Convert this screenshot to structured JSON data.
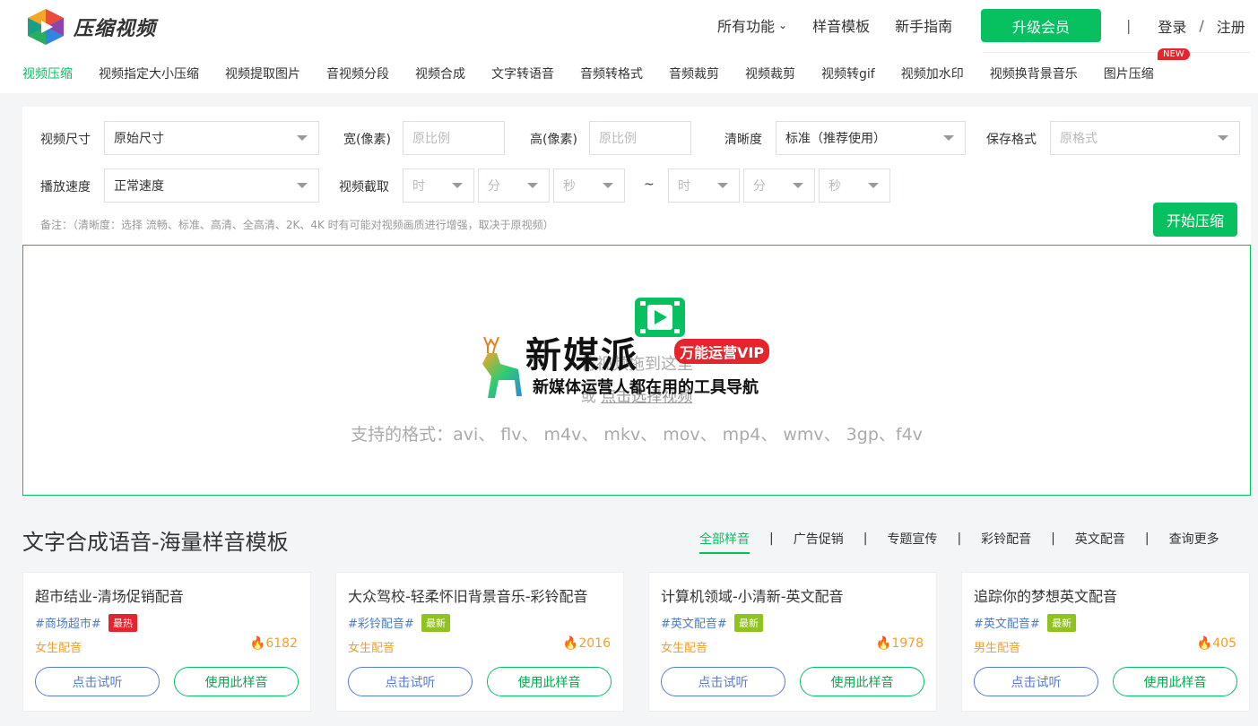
{
  "brand": {
    "name": "压缩视频"
  },
  "topnav": {
    "all_features": "所有功能",
    "templates": "样音模板",
    "guide": "新手指南",
    "upgrade": "升级会员",
    "sep1": "|",
    "login": "登录",
    "sep2": "/",
    "register": "注册"
  },
  "tools": [
    {
      "label": "视频压缩",
      "active": true
    },
    {
      "label": "视频指定大小压缩"
    },
    {
      "label": "视频提取图片"
    },
    {
      "label": "音视频分段"
    },
    {
      "label": "视频合成"
    },
    {
      "label": "文字转语音"
    },
    {
      "label": "音频转格式"
    },
    {
      "label": "音频裁剪"
    },
    {
      "label": "视频裁剪"
    },
    {
      "label": "视频转gif"
    },
    {
      "label": "视频加水印"
    },
    {
      "label": "视频换背景音乐"
    },
    {
      "label": "图片压缩",
      "badge": "NEW"
    }
  ],
  "form": {
    "size_label": "视频尺寸",
    "size_value": "原始尺寸",
    "width_label": "宽(像素)",
    "width_placeholder": "原比例",
    "height_label": "高(像素)",
    "height_placeholder": "原比例",
    "quality_label": "清晰度",
    "quality_value": "标准（推荐使用）",
    "format_label": "保存格式",
    "format_placeholder": "原格式",
    "speed_label": "播放速度",
    "speed_value": "正常速度",
    "clip_label": "视频截取",
    "hour": "时",
    "minute": "分",
    "second": "秒",
    "tilde": "~",
    "note": "备注：（清晰度：选择 流畅、标准、高清、全高清、2K、4K 时有可能对视频画质进行增强，取决于原视频）",
    "start_button": "开始压缩"
  },
  "dropzone": {
    "drag_hint": "将视频拖到这里",
    "or_text": "或",
    "select_link": "点击选择视频",
    "formats": "支持的格式：avi、 flv、 m4v、 mkv、 mov、 mp4、 wmv、 3gp、f4v"
  },
  "overlay": {
    "title": "新媒派",
    "badge": "万能运营VIP",
    "subtitle": "新媒体运营人都在用的工具导航"
  },
  "templates": {
    "title": "文字合成语音-海量样音模板",
    "tabs": [
      "全部样音",
      "广告促销",
      "专题宣传",
      "彩铃配音",
      "英文配音",
      "查询更多"
    ],
    "active_tab": "全部样音",
    "cards": [
      {
        "title": "超市结业-清场促销配音",
        "tag": "#商场超市#",
        "badge": "最热",
        "badge_type": "hot",
        "voice": "女生配音",
        "count": "6182",
        "try": "点击试听",
        "use": "使用此样音"
      },
      {
        "title": "大众驾校-轻柔怀旧背景音乐-彩铃配音",
        "tag": "#彩铃配音#",
        "badge": "最新",
        "badge_type": "new",
        "voice": "女生配音",
        "count": "2016",
        "try": "点击试听",
        "use": "使用此样音"
      },
      {
        "title": "计算机领域-小清新-英文配音",
        "tag": "#英文配音#",
        "badge": "最新",
        "badge_type": "new",
        "voice": "女生配音",
        "count": "1978",
        "try": "点击试听",
        "use": "使用此样音"
      },
      {
        "title": "追踪你的梦想英文配音",
        "tag": "#英文配音#",
        "badge": "最新",
        "badge_type": "new",
        "voice": "男生配音",
        "count": "405",
        "try": "点击试听",
        "use": "使用此样音"
      }
    ]
  },
  "colors": {
    "accent": "#07c160",
    "hot": "#e5242b",
    "new": "#8fc31f",
    "link": "#4b7bcf",
    "orange": "#f0a030"
  }
}
